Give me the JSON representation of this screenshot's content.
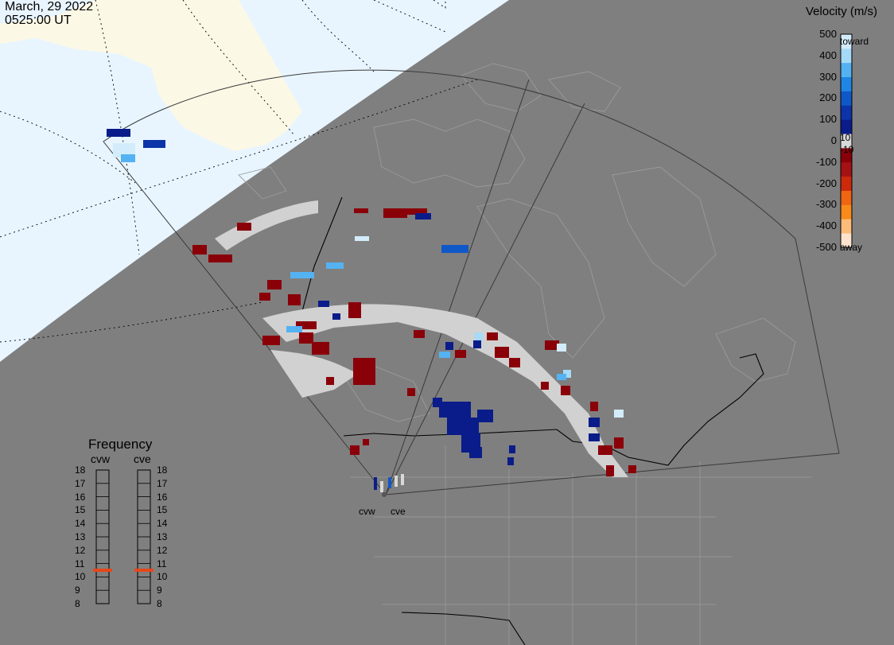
{
  "header": {
    "date": "March, 29 2022",
    "time": "0525:00 UT"
  },
  "velocity_scale": {
    "title": "Velocity (m/s)",
    "ticks": [
      "500",
      "400",
      "300",
      "200",
      "100",
      "0",
      "-100",
      "-200",
      "-300",
      "-400",
      "-500"
    ],
    "inner_labels": [
      "10",
      "-10"
    ],
    "toward_label": "toward",
    "away_label": "away",
    "colors": [
      "#fde3cd",
      "#fcbd7a",
      "#f88b1c",
      "#ef6512",
      "#cc2a0b",
      "#a51214",
      "#8a0009",
      "#d8d8d8",
      "#0a1c8a",
      "#0c33a8",
      "#0f58c8",
      "#1f86e6",
      "#54b2f2",
      "#a5daf8",
      "#d3ecfb"
    ]
  },
  "frequency_panel": {
    "title": "Frequency",
    "radars": [
      "cvw",
      "cve"
    ],
    "ticks": [
      "18",
      "17",
      "16",
      "15",
      "14",
      "13",
      "12",
      "11",
      "10",
      "9",
      "8"
    ],
    "current_mhz": [
      10.5,
      10.5
    ],
    "marker_color": "#e8461b"
  },
  "map": {
    "sites": [
      "cvw",
      "cve"
    ],
    "colors": {
      "night": "#7f7f7f",
      "day_ocean": "#e8f5ff",
      "day_land": "#fcf8e6",
      "coastline": "#9a9a9a",
      "border": "#000000",
      "fov": "#3a3a3a"
    }
  }
}
